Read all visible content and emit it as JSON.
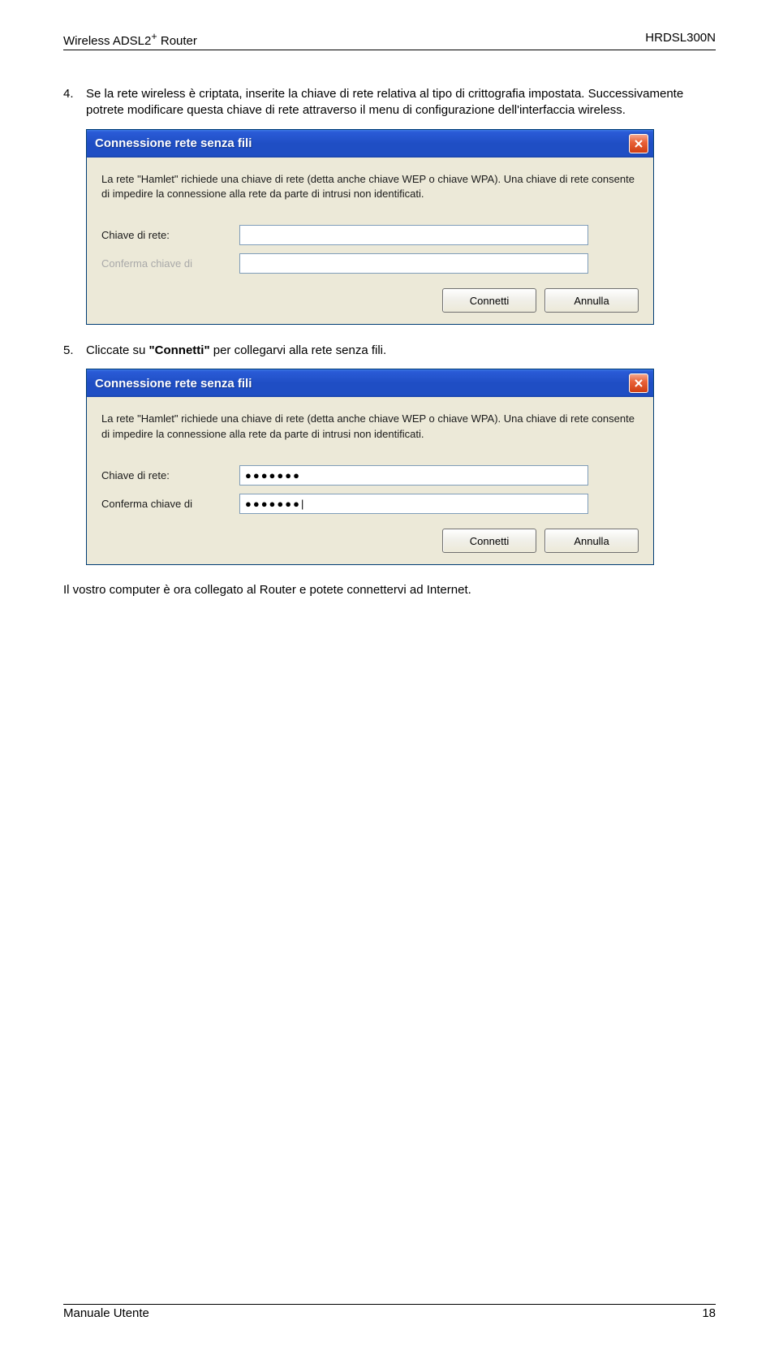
{
  "header": {
    "left_prefix": "Wireless ADSL2",
    "left_suffix": " Router",
    "sup": "+",
    "right": "HRDSL300N"
  },
  "step4": {
    "num": "4.",
    "text": "Se la rete wireless è criptata, inserite la chiave di rete relativa al tipo di crittografia impostata. Successivamente potrete modificare questa chiave di rete attraverso il menu di configurazione dell'interfaccia wireless."
  },
  "dialog1": {
    "title": "Connessione rete senza fili",
    "desc": "La rete \"Hamlet\" richiede una chiave di rete (detta anche chiave WEP o chiave WPA). Una chiave di rete consente di impedire la connessione alla rete da parte di intrusi non identificati.",
    "label_key": "Chiave di rete:",
    "label_confirm": "Conferma chiave di",
    "value_key": "",
    "value_confirm": "",
    "btn_connect": "Connetti",
    "btn_cancel": "Annulla"
  },
  "step5": {
    "num": "5.",
    "text_prefix": "Cliccate su ",
    "text_bold": "\"Connetti\"",
    "text_suffix": " per collegarvi alla rete senza fili."
  },
  "dialog2": {
    "title": "Connessione rete senza fili",
    "desc": "La rete \"Hamlet\" richiede una chiave di rete (detta anche chiave WEP o chiave WPA). Una chiave di rete consente di impedire la connessione alla rete da parte di intrusi non identificati.",
    "label_key": "Chiave di rete:",
    "label_confirm": "Conferma chiave di",
    "value_key": "●●●●●●●",
    "value_confirm": "●●●●●●●|",
    "btn_connect": "Connetti",
    "btn_cancel": "Annulla"
  },
  "final": "Il vostro computer è ora collegato al Router e potete connettervi ad Internet.",
  "footer": {
    "left": "Manuale Utente",
    "right": "18"
  }
}
